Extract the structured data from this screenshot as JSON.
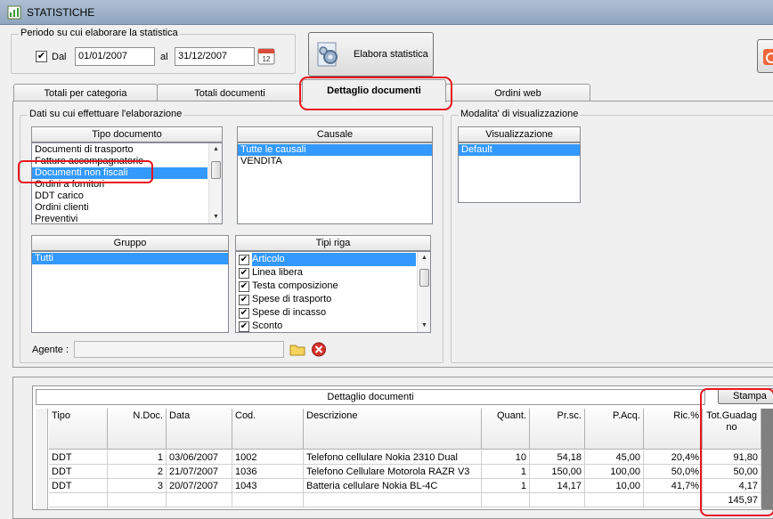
{
  "window": {
    "title": "STATISTICHE"
  },
  "period": {
    "group_label": "Periodo su cui elaborare la statistica",
    "from_checked": true,
    "from_label": "Dal",
    "from_value": "01/01/2007",
    "to_label": "al",
    "to_value": "31/12/2007"
  },
  "toolbar": {
    "elabora_label": "Elabora statistica"
  },
  "tabs": [
    {
      "label": "Totali per categoria",
      "active": false
    },
    {
      "label": "Totali documenti",
      "active": false
    },
    {
      "label": "Dettaglio documenti",
      "active": true
    },
    {
      "label": "Ordini web",
      "active": false
    }
  ],
  "filters": {
    "group_label": "Dati su cui effettuare l'elaborazione",
    "tipo_documento": {
      "header": "Tipo documento",
      "items": [
        {
          "label": "Documenti di trasporto",
          "selected": false,
          "strike": false
        },
        {
          "label": "Fatture accompagnatorie",
          "selected": false,
          "strike": true
        },
        {
          "label": "Documenti non fiscali",
          "selected": true,
          "strike": false
        },
        {
          "label": "Ordini a fornitori",
          "selected": false,
          "strike": false
        },
        {
          "label": "DDT carico",
          "selected": false,
          "strike": false
        },
        {
          "label": "Ordini clienti",
          "selected": false,
          "strike": false
        },
        {
          "label": "Preventivi",
          "selected": false,
          "strike": false
        }
      ]
    },
    "causale": {
      "header": "Causale",
      "items": [
        {
          "label": "Tutte le causali",
          "selected": true
        },
        {
          "label": "VENDITA",
          "selected": false
        }
      ]
    },
    "gruppo": {
      "header": "Gruppo",
      "items": [
        {
          "label": "Tutti",
          "selected": true
        }
      ]
    },
    "tipi_riga": {
      "header": "Tipi riga",
      "items": [
        {
          "label": "Articolo",
          "checked": true,
          "selected": true
        },
        {
          "label": "Linea libera",
          "checked": true,
          "selected": false
        },
        {
          "label": "Testa composizione",
          "checked": true,
          "selected": false
        },
        {
          "label": "Spese di trasporto",
          "checked": true,
          "selected": false
        },
        {
          "label": "Spese di incasso",
          "checked": true,
          "selected": false
        },
        {
          "label": "Sconto",
          "checked": true,
          "selected": false
        }
      ]
    },
    "agente_label": "Agente :",
    "agente_value": ""
  },
  "visualizzazione": {
    "group_label": "Modalita' di visualizzazione",
    "header": "Visualizzazione",
    "items": [
      {
        "label": "Default",
        "selected": true
      }
    ]
  },
  "grid": {
    "title": "Dettaglio documenti",
    "stampa_label": "Stampa",
    "columns": [
      "Tipo",
      "N.Doc.",
      "Data",
      "Cod.",
      "Descrizione",
      "Quant.",
      "Pr.sc.",
      "P.Acq.",
      "Ric.%",
      "Tot.Guadagno"
    ],
    "rows": [
      [
        "DDT",
        "1",
        "03/06/2007",
        "1002",
        "Telefono cellulare Nokia 2310 Dual",
        "10",
        "54,18",
        "45,00",
        "20,4%",
        "91,80"
      ],
      [
        "DDT",
        "2",
        "21/07/2007",
        "1036",
        "Telefono Cellulare Motorola RAZR V3",
        "1",
        "150,00",
        "100,00",
        "50,0%",
        "50,00"
      ],
      [
        "DDT",
        "3",
        "20/07/2007",
        "1043",
        "Batteria cellulare Nokia BL-4C",
        "1",
        "14,17",
        "10,00",
        "41,7%",
        "4,17"
      ]
    ],
    "total": "145,97"
  },
  "colors": {
    "selection": "#3399ff",
    "annotation": "#e8141c"
  }
}
